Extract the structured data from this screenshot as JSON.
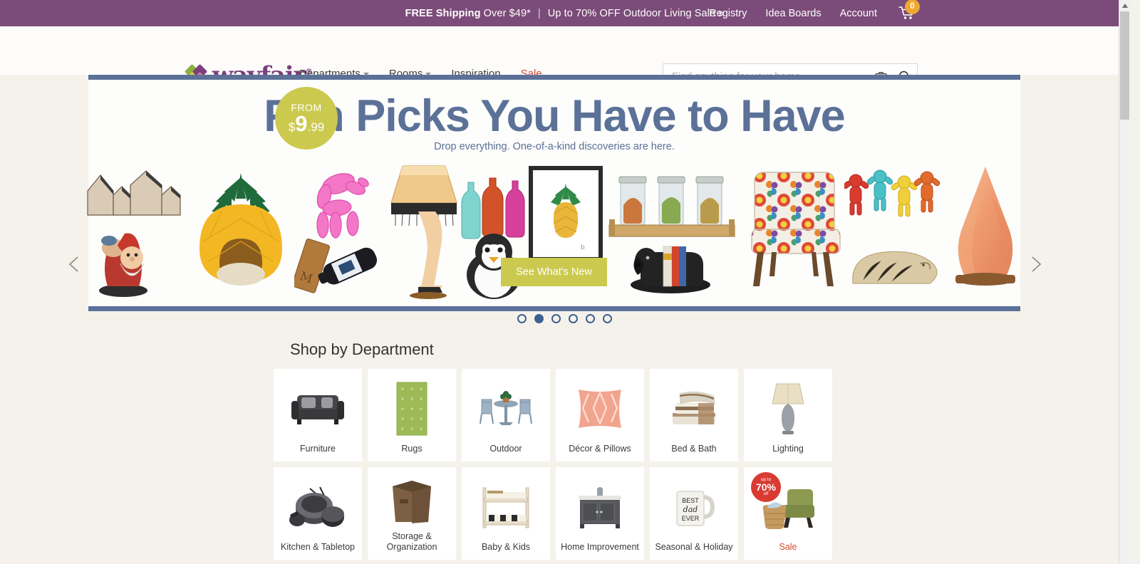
{
  "promo": {
    "free_shipping_bold": "FREE Shipping",
    "free_shipping_rest": " Over $49*",
    "separator": "|",
    "sale_link": "Up to 70% OFF Outdoor Living Sale »",
    "links": [
      "Registry",
      "Idea Boards",
      "Account"
    ],
    "cart_count": "0",
    "cart_icon": "shopping-cart-icon",
    "background_color": "#7b4b79"
  },
  "header": {
    "logo_text": "wayfair",
    "logo_trademark": "®",
    "nav": [
      {
        "label": "Departments",
        "has_caret": true,
        "sale": false
      },
      {
        "label": "Rooms",
        "has_caret": true,
        "sale": false
      },
      {
        "label": "Inspiration",
        "has_caret": false,
        "sale": false
      },
      {
        "label": "Sale",
        "has_caret": false,
        "sale": true
      }
    ],
    "search": {
      "placeholder": "Find anything for your home...",
      "value": "",
      "camera_icon": "camera-icon",
      "search_icon": "search-icon"
    }
  },
  "hero": {
    "badge": {
      "from": "FROM",
      "dollar": "$",
      "amount": "9",
      "cents": ".99"
    },
    "title": "Fun Picks You Have to Have",
    "subtitle": "Drop everything. One-of-a-kind discoveries are here.",
    "cta_label": "See What's New",
    "prev_icon": "chevron-left-icon",
    "next_icon": "chevron-right-icon",
    "title_color": "#5b7197",
    "accent_color": "#ccc94f",
    "border_color": "#5b7197",
    "products": [
      "wall-shelf-houses",
      "garden-gnome",
      "pineapple-pet-bed",
      "balloon-dog-sculpture",
      "wine-bottle-board",
      "leg-lamp",
      "colored-glass-bottles",
      "penguin-figurine",
      "pineapple-framed-art",
      "mason-jar-tray",
      "dachshund-bookend",
      "floral-accent-chair",
      "gummy-bear-figures",
      "hedgehog-doormat",
      "himalayan-salt-lamp"
    ],
    "dots": {
      "total": 6,
      "active_index": 1
    }
  },
  "departments": {
    "title": "Shop by Department",
    "cards": [
      {
        "label": "Furniture",
        "thumb": "sofa-thumb",
        "sale": false
      },
      {
        "label": "Rugs",
        "thumb": "rug-thumb",
        "sale": false
      },
      {
        "label": "Outdoor",
        "thumb": "patio-set-thumb",
        "sale": false
      },
      {
        "label": "Décor & Pillows",
        "thumb": "pillow-thumb",
        "sale": false
      },
      {
        "label": "Bed & Bath",
        "thumb": "towels-thumb",
        "sale": false
      },
      {
        "label": "Lighting",
        "thumb": "table-lamp-thumb",
        "sale": false
      },
      {
        "label": "Kitchen & Tabletop",
        "thumb": "cookware-thumb",
        "sale": false
      },
      {
        "label": "Storage & Organization",
        "thumb": "storage-bin-thumb",
        "sale": false
      },
      {
        "label": "Baby & Kids",
        "thumb": "bunk-bed-thumb",
        "sale": false
      },
      {
        "label": "Home Improvement",
        "thumb": "vanity-thumb",
        "sale": false
      },
      {
        "label": "Seasonal & Holiday",
        "thumb": "mug-thumb",
        "sale": false
      },
      {
        "label": "Sale",
        "thumb": "armchair-thumb",
        "sale": true,
        "badge": {
          "line1": "up to",
          "line2": "70%",
          "line3": "off"
        }
      }
    ]
  },
  "scrollbar": {
    "thumb_position": "near-top"
  }
}
